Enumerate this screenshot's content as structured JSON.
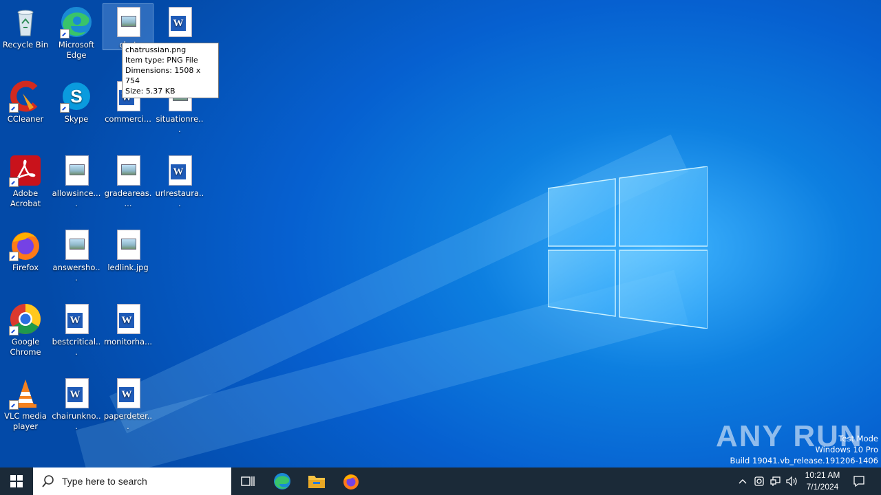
{
  "desktop": {
    "icons": [
      {
        "label": "Recycle Bin",
        "icon": "recycle-bin-icon"
      },
      {
        "label": "Microsoft Edge",
        "icon": "edge-icon"
      },
      {
        "label": "chat",
        "icon": "image-file-icon"
      },
      {
        "label": "",
        "icon": "word-doc-icon"
      },
      {
        "label": "CCleaner",
        "icon": "ccleaner-icon"
      },
      {
        "label": "Skype",
        "icon": "skype-icon"
      },
      {
        "label": "commerci...",
        "icon": "word-doc-icon"
      },
      {
        "label": "situationre...",
        "icon": "image-file-icon"
      },
      {
        "label": "Adobe Acrobat",
        "icon": "acrobat-icon"
      },
      {
        "label": "allowsince....",
        "icon": "image-file-icon"
      },
      {
        "label": "gradeareas....",
        "icon": "image-file-icon"
      },
      {
        "label": "urlrestaura...",
        "icon": "word-doc-icon"
      },
      {
        "label": "Firefox",
        "icon": "firefox-icon"
      },
      {
        "label": "answersho...",
        "icon": "image-file-icon"
      },
      {
        "label": "ledlink.jpg",
        "icon": "image-file-icon"
      },
      {
        "label": "Google Chrome",
        "icon": "chrome-icon"
      },
      {
        "label": "bestcritical...",
        "icon": "word-doc-icon"
      },
      {
        "label": "monitorha...",
        "icon": "word-doc-icon"
      },
      {
        "label": "VLC media player",
        "icon": "vlc-icon"
      },
      {
        "label": "chairunkno...",
        "icon": "word-doc-icon"
      },
      {
        "label": "paperdeter...",
        "icon": "word-doc-icon"
      }
    ]
  },
  "tooltip": {
    "line1": "chatrussian.png",
    "line2": "Item type: PNG File",
    "line3": "Dimensions: 1508 x 754",
    "line4": "Size: 5.37 KB"
  },
  "watermark": {
    "brand": "ANY RUN",
    "line1": "Test Mode",
    "line2": "Windows 10 Pro",
    "line3": "Build 19041.vb_release.191206-1406"
  },
  "taskbar": {
    "search_placeholder": "Type here to search",
    "time": "10:21 AM",
    "date": "7/1/2024"
  },
  "colors": {
    "accent": "#0a74da",
    "taskbar": "#1b2a38"
  }
}
